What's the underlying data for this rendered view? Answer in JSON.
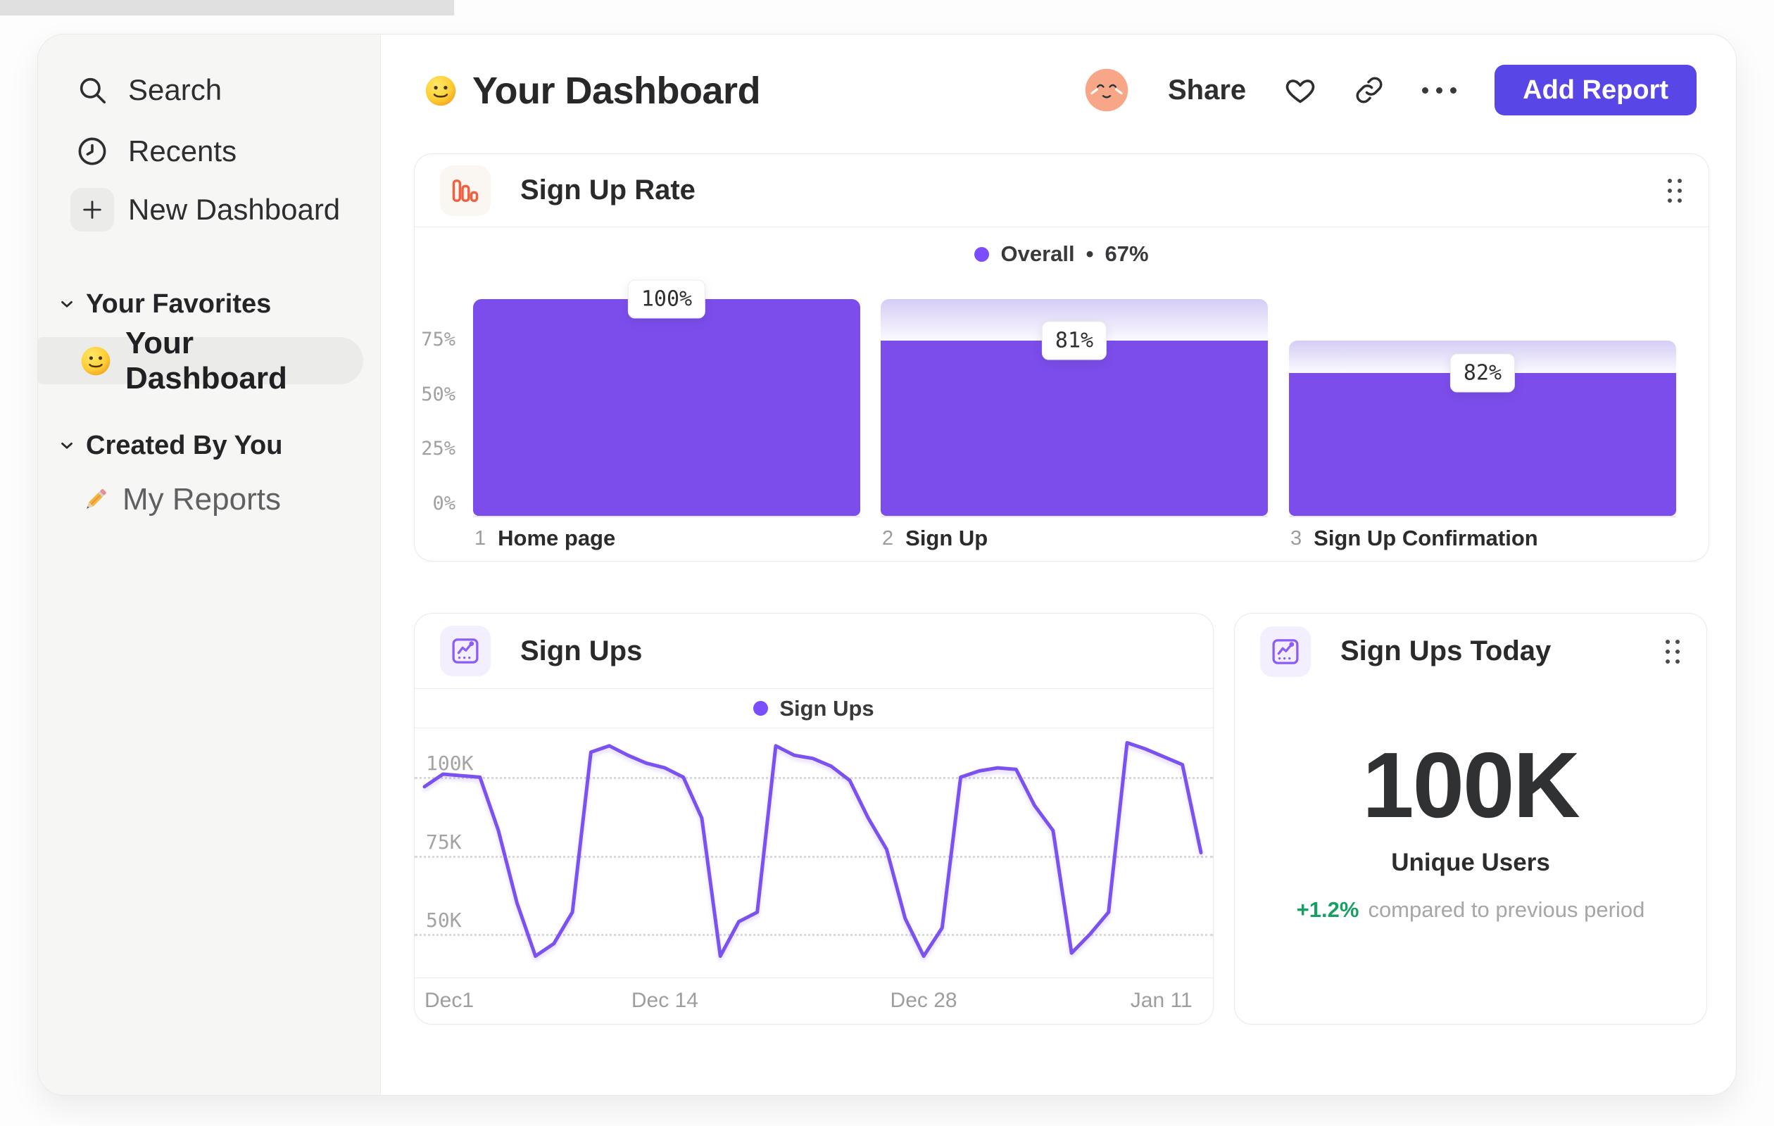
{
  "sidebar": {
    "nav": [
      {
        "icon": "search-icon",
        "label": "Search"
      },
      {
        "icon": "clock-icon",
        "label": "Recents"
      },
      {
        "icon": "plus-icon",
        "label": "New Dashboard"
      }
    ],
    "sections": [
      {
        "label": "Your Favorites",
        "items": [
          {
            "emoji": "smiley-emoji",
            "label": "Your Dashboard",
            "selected": true
          }
        ]
      },
      {
        "label": "Created By You",
        "items": [
          {
            "emoji": "pencil-emoji",
            "label": "My Reports",
            "selected": false
          }
        ]
      }
    ]
  },
  "header": {
    "emoji": "smiley-emoji",
    "title": "Your Dashboard",
    "share_label": "Share",
    "add_report_label": "Add Report",
    "accent_color": "#5847e6",
    "avatar_color": "#f7a787"
  },
  "cards": {
    "signup_rate": {
      "title": "Sign Up Rate",
      "icon": "funnel-bars-icon",
      "icon_color": "#f0603f",
      "legend_label": "Overall",
      "legend_sep": "•",
      "legend_value": "67%"
    },
    "signups": {
      "title": "Sign Ups",
      "icon": "line-chart-icon",
      "icon_color": "#8b5cf6",
      "legend_label": "Sign Ups"
    },
    "signups_today": {
      "title": "Sign Ups Today",
      "icon": "line-chart-icon",
      "value": "100K",
      "value_label": "Unique Users",
      "delta": "+1.2%",
      "delta_color": "#16a163",
      "delta_note": "compared to previous period"
    }
  },
  "chart_data": [
    {
      "id": "signup_rate_funnel",
      "type": "bar",
      "title": "Sign Up Rate",
      "legend": "Overall • 67%",
      "categories": [
        "Home page",
        "Sign Up",
        "Sign Up Confirmation"
      ],
      "step_numbers": [
        "1",
        "2",
        "3"
      ],
      "bar_labels": [
        "100%",
        "81%",
        "82%"
      ],
      "step_conversion_pct": [
        100,
        81,
        82
      ],
      "cumulative_pct": [
        100,
        81,
        66
      ],
      "prev_cumulative_pct": [
        100,
        100,
        81
      ],
      "yticks": [
        {
          "v": 75,
          "label": "75%"
        },
        {
          "v": 50,
          "label": "50%"
        },
        {
          "v": 25,
          "label": "25%"
        },
        {
          "v": 0,
          "label": "0%"
        }
      ],
      "ylim": [
        0,
        100
      ],
      "bar_color": "#7c4deb",
      "legend_dot_color": "#7c4dff",
      "grid": false,
      "legend_position": "top-center"
    },
    {
      "id": "signups_line",
      "type": "line",
      "title": "Sign Ups",
      "legend": "Sign Ups",
      "unit": "K",
      "values": [
        97,
        101,
        100.5,
        100,
        83,
        60,
        43,
        47,
        57,
        108,
        110,
        107,
        104.5,
        103,
        100,
        87,
        43,
        54,
        57,
        110,
        107,
        106,
        103.5,
        99,
        87,
        77,
        55,
        43,
        52,
        100,
        102,
        103,
        102.5,
        91,
        83,
        44,
        50,
        57,
        111,
        109,
        106.5,
        104,
        76
      ],
      "yticks": [
        {
          "v": 100,
          "label": "100K"
        },
        {
          "v": 75,
          "label": "75K"
        },
        {
          "v": 50,
          "label": "50K"
        }
      ],
      "xticks": [
        {
          "i": 0,
          "label": "Dec1"
        },
        {
          "i": 13,
          "label": "Dec 14"
        },
        {
          "i": 27,
          "label": "Dec 28"
        },
        {
          "i": 41,
          "label": "Jan 11"
        }
      ],
      "ylim": [
        40,
        114
      ],
      "line_color": "#7b52f0",
      "grid": "dotted",
      "legend_position": "top-center"
    },
    {
      "id": "signups_today_metric",
      "type": "metric",
      "title": "Sign Ups Today",
      "value": "100K",
      "label": "Unique Users",
      "delta": "+1.2%",
      "delta_note": "compared to previous period"
    }
  ]
}
